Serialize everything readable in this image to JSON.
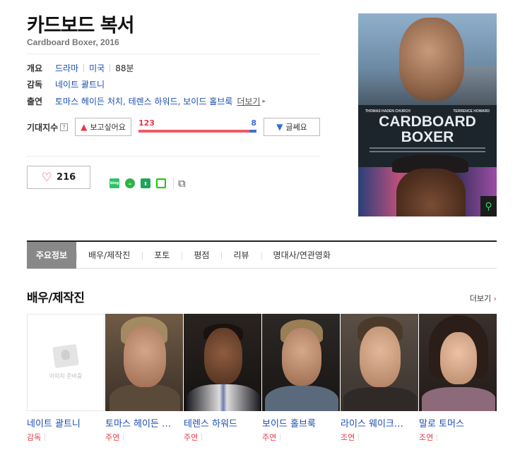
{
  "movie": {
    "title": "카드보드 복서",
    "subtitle": "Cardboard Boxer, 2016"
  },
  "overview": {
    "label": "개요",
    "genre": "드라마",
    "country": "미국",
    "runtime": "88분"
  },
  "director": {
    "label": "감독",
    "name": "네이트 괄트니"
  },
  "cast_info": {
    "label": "출연",
    "names": "토마스 헤이든 처치, 테렌스 하워드, 보이드 홀브룩",
    "more": "더보기"
  },
  "expectation": {
    "label": "기대지수",
    "help": "?",
    "want_label": "보고싶어요",
    "want_count": "123",
    "dislike_count": "8",
    "dislike_label": "글쎄요",
    "want_ratio": 0.939
  },
  "like": {
    "count": "216"
  },
  "share": {
    "blog_label": "blog"
  },
  "poster": {
    "actor1": "THOMAS HADEN CHURCH",
    "actor2": "TERRENCE HOWARD",
    "title_line1": "CARDBOARD",
    "title_line2": "BOXER"
  },
  "tabs": [
    "주요정보",
    "배우/제작진",
    "포토",
    "평점",
    "리뷰",
    "명대사/연관영화"
  ],
  "cast_section": {
    "title": "배우/제작진",
    "more": "더보기",
    "no_image_text": "이미지 준비중",
    "people": [
      {
        "name": "네이트 괄트니",
        "role": "감독"
      },
      {
        "name": "토마스 헤이든 …",
        "role": "주연"
      },
      {
        "name": "테렌스 하워드",
        "role": "주연"
      },
      {
        "name": "보이드 홀브룩",
        "role": "주연"
      },
      {
        "name": "라이스 웨이크…",
        "role": "조연"
      },
      {
        "name": "말로 토머스",
        "role": "조연"
      }
    ]
  },
  "colors": {
    "accent_red": "#e53a45",
    "accent_blue": "#1a4db0",
    "naver_green": "#1ec800"
  }
}
